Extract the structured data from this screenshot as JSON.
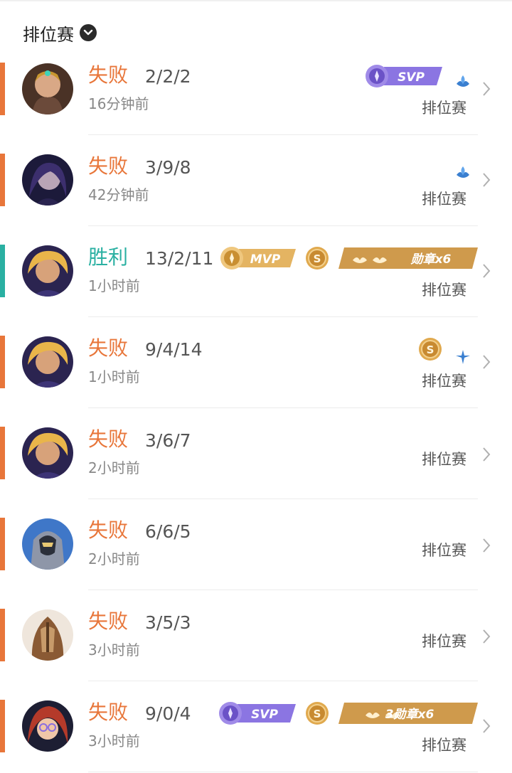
{
  "filter": {
    "label": "排位赛"
  },
  "colors": {
    "loss": "#e8763a",
    "win": "#2ab0a2",
    "svp": "#7f67d8",
    "mvp": "#d8a24c",
    "gold": "#d59a43"
  },
  "matches": [
    {
      "result": "失败",
      "kda": "2/2/2",
      "time": "16分钟前",
      "mode": "排位赛",
      "outcome": "loss",
      "badges": [
        "svp-badge",
        "lotus-icon"
      ]
    },
    {
      "result": "失败",
      "kda": "3/9/8",
      "time": "42分钟前",
      "mode": "排位赛",
      "outcome": "loss",
      "badges": [
        "lotus-icon"
      ]
    },
    {
      "result": "胜利",
      "kda": "13/2/11",
      "time": "1小时前",
      "mode": "排位赛",
      "outcome": "win",
      "badges": [
        "mvp-badge",
        "s-coin",
        "medal-badge"
      ],
      "medal_text": "勋章x6"
    },
    {
      "result": "失败",
      "kda": "9/4/14",
      "time": "1小时前",
      "mode": "排位赛",
      "outcome": "loss",
      "badges": [
        "s-coin",
        "compass-icon"
      ]
    },
    {
      "result": "失败",
      "kda": "3/6/7",
      "time": "2小时前",
      "mode": "排位赛",
      "outcome": "loss",
      "badges": []
    },
    {
      "result": "失败",
      "kda": "6/6/5",
      "time": "2小时前",
      "mode": "排位赛",
      "outcome": "loss",
      "badges": []
    },
    {
      "result": "失败",
      "kda": "3/5/3",
      "time": "3小时前",
      "mode": "排位赛",
      "outcome": "loss",
      "badges": []
    },
    {
      "result": "失败",
      "kda": "9/0/4",
      "time": "3小时前",
      "mode": "排位赛",
      "outcome": "loss",
      "badges": [
        "svp-badge",
        "s-coin",
        "medal-badge"
      ],
      "medal_text": "3勋章x6"
    }
  ],
  "labels": {
    "svp": "SVP",
    "mvp": "MVP",
    "s": "S"
  }
}
